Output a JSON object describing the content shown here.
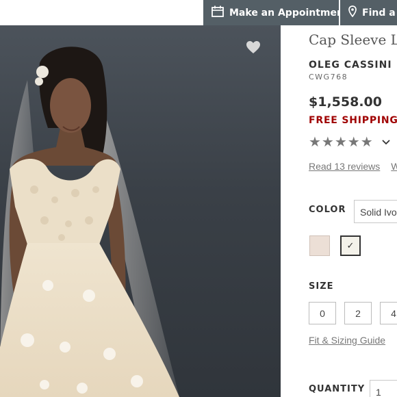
{
  "header": {
    "appointment_label": "Make an Appointment",
    "store_label": "Find a St",
    "bar_color": "#545f66"
  },
  "product": {
    "title": "Cap Sleeve La",
    "brand": "OLEG CASSINI",
    "sku": "CWG768",
    "price": "$1,558.00",
    "shipping": "FREE SHIPPING ON",
    "stars": "★★★★★",
    "rating_toggle_icon": "chevron-down-icon",
    "reviews_link": "Read 13 reviews",
    "write_link": "W"
  },
  "color": {
    "label": "COLOR",
    "selected": "Solid Ivory",
    "swatches": [
      {
        "color": "#ecdfd6"
      },
      {
        "color": "#f4f2ea",
        "check": "✓"
      }
    ]
  },
  "size": {
    "label": "SIZE",
    "options": [
      "0",
      "2",
      "4"
    ],
    "fit_link": "Fit & Sizing Guide"
  },
  "quantity": {
    "label": "QUANTITY",
    "value": "1"
  },
  "colors": {
    "sale_red": "#a00000",
    "backdrop": "#3a4047"
  }
}
